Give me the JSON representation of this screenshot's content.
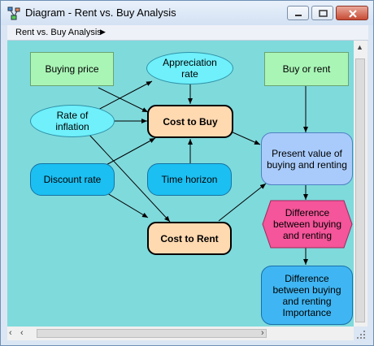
{
  "window": {
    "title": "Diagram - Rent vs. Buy Analysis"
  },
  "breadcrumb": {
    "label": "Rent vs. Buy Analysis"
  },
  "nodes": {
    "buying_price": "Buying price",
    "appreciation_rate": "Appreciation rate",
    "buy_or_rent": "Buy or rent",
    "rate_of_inflation": "Rate of inflation",
    "cost_to_buy": "Cost to Buy",
    "present_value": "Present value of buying and renting",
    "discount_rate": "Discount rate",
    "time_horizon": "Time horizon",
    "difference": "Difference between buying and renting",
    "cost_to_rent": "Cost to Rent",
    "difference_importance": "Difference between buying and renting Importance"
  },
  "colors": {
    "canvas": "#7fdadc",
    "decision": "#a9f5b6",
    "chance": "#6ff0fb",
    "constant": "#1bbff2",
    "objective": "#ffd9b0",
    "variable": "#a9cbfb",
    "utility": "#f5559a"
  },
  "icons": [
    "app-diagram-icon",
    "minimize-icon",
    "maximize-icon",
    "close-icon",
    "breadcrumb-arrow-icon",
    "scroll-left-icon",
    "scroll-right-icon",
    "scroll-up-icon",
    "resize-grip-icon"
  ]
}
